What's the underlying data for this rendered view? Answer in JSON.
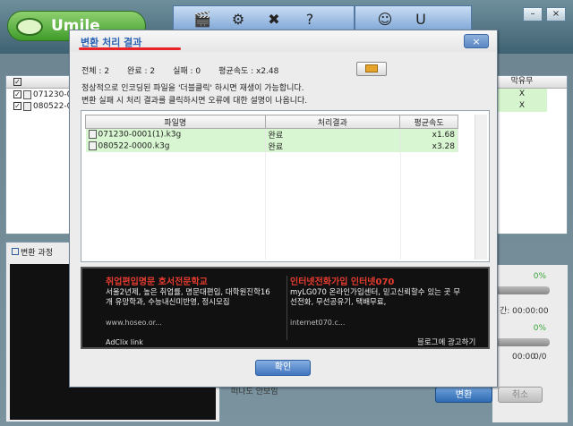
{
  "app": {
    "logo_text": "Umile",
    "toolbar_icons": [
      "film-icon",
      "reel-icon",
      "tools-icon",
      "help-icon",
      "frog-icon",
      "update-icon"
    ],
    "list_col_subtitle": "막유무",
    "list_rows": [
      {
        "name": "071230-0",
        "subtitle": "X"
      },
      {
        "name": "080522-0",
        "subtitle": "X"
      }
    ],
    "progress_tab_label": "변환 과정",
    "progress_pct_1": "0%",
    "progress_pct_2": "0%",
    "time_label": "간: 00:00:00",
    "time_value": "00:00",
    "count_value": "0/0",
    "bottom_checkbox_label": "떠나도 안보임",
    "convert_button": "변환",
    "cancel_button": "취소"
  },
  "dialog": {
    "title": "변환 처리 결과",
    "close_label": "×",
    "stats": {
      "total": "전체 : 2",
      "done": "완료 : 2",
      "failed": "실패 : 0",
      "avg_speed": "평균속도 : x2.48"
    },
    "note1": "정상적으로 인코딩된 파일을 '더블클릭' 하시면 재생이 가능합니다.",
    "note2": "변환 실패 시 처리 결과를 클릭하시면 오류에 대한 설명이 나옵니다.",
    "table": {
      "headers": [
        "파일명",
        "처리결과",
        "평균속도"
      ],
      "rows": [
        {
          "file": "071230-0001(1).k3g",
          "result": "완료",
          "speed": "x1.68"
        },
        {
          "file": "080522-0000.k3g",
          "result": "완료",
          "speed": "x3.28"
        }
      ]
    },
    "ad": {
      "left_title": "취업편입명문 호서전문학교",
      "left_body": "서울2년제, 높은 취업률, 명문대편입, 대학원진학16개 유망학과, 수능내신미반영, 정시모집",
      "left_url": "www.hoseo.or...",
      "right_title": "인터넷전화가입 인터넷070",
      "right_body": "myLG070 온라인가입센터, 믿고신뢰할수 있는 곳 무선전화, 무선공유기, 택배무료,",
      "right_url": "internet070.c...",
      "adclix": "AdClix link",
      "promote": "블로그에 광고하기"
    },
    "ok_label": "확인"
  }
}
